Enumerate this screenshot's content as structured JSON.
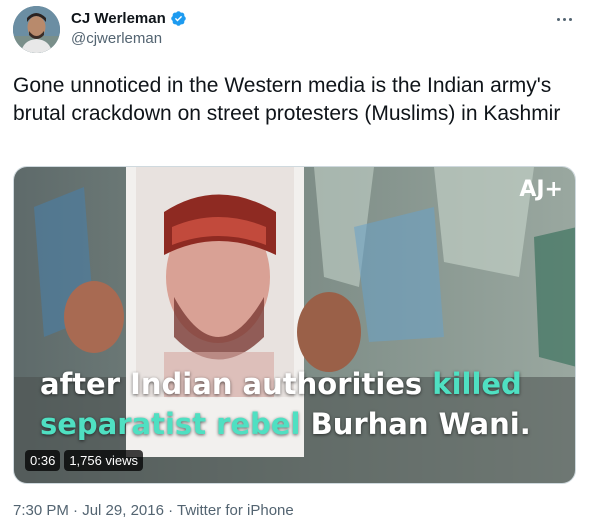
{
  "author": {
    "display_name": "CJ Werleman",
    "handle": "@cjwerleman",
    "verified": true
  },
  "tweet": {
    "text": "Gone unnoticed in the Western media is the Indian army's brutal crackdown on street protesters (Muslims) in Kashmir"
  },
  "media": {
    "logo": "AJ+",
    "caption_line1_white": "after Indian authorities ",
    "caption_line1_teal": "killed",
    "caption_line2_teal": "separatist rebel ",
    "caption_line2_white": "Burhan Wani.",
    "duration": "0:36",
    "views": "1,756 views"
  },
  "meta": {
    "time": "7:30 PM",
    "date": "Jul 29, 2016",
    "source": "Twitter for iPhone",
    "separator": " · "
  },
  "icons": {
    "verified": "verified-badge-icon",
    "more": "more-horizontal-icon"
  },
  "colors": {
    "verified": "#1d9bf0",
    "teal_caption": "#4fe0c2",
    "muted_text": "#536471"
  }
}
